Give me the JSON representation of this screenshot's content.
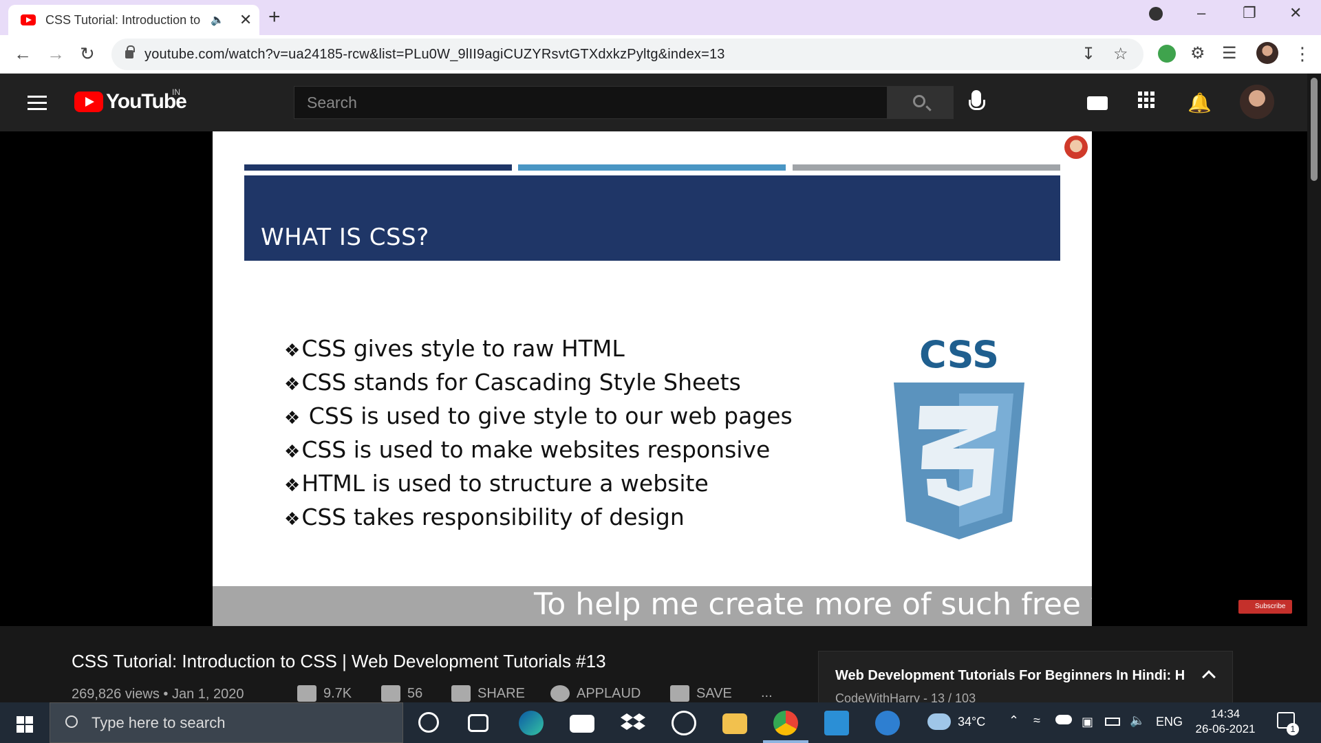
{
  "browser": {
    "tab_title": "CSS Tutorial: Introduction to",
    "url": "youtube.com/watch?v=ua24185-rcw&list=PLu0W_9lII9agiCUZYRsvtGTXdxkzPyltg&index=13"
  },
  "youtube": {
    "country_code": "IN",
    "logo_text": "YouTube",
    "search_placeholder": "Search"
  },
  "slide": {
    "heading": "WHAT IS CSS?",
    "bullets": [
      "CSS gives style to raw HTML",
      "CSS stands for Cascading Style Sheets",
      " CSS is used to give style to our web pages",
      "CSS is used to make websites responsive",
      "HTML is used to structure a website",
      "CSS takes responsibility of design"
    ],
    "logo_text": "CSS",
    "subtitle": "To help me create more of such free video",
    "subscribe_badge": "Subscribe",
    "stripe_colors": [
      "#1f3667",
      "#4a96c4",
      "#a0a4a8"
    ]
  },
  "video": {
    "title": "CSS Tutorial: Introduction to CSS | Web Development Tutorials #13",
    "meta": "269,826 views • Jan 1, 2020",
    "likes": "9.7K",
    "dislikes": "56",
    "share": "SHARE",
    "applaud": "APPLAUD",
    "save": "SAVE",
    "more": "..."
  },
  "playlist": {
    "title": "Web Development Tutorials For Beginners In Hindi: H",
    "channel_position": "CodeWithHarry - 13 / 103"
  },
  "taskbar": {
    "search_placeholder": "Type here to search",
    "weather": "34°C",
    "language": "ENG",
    "time": "14:34",
    "date": "26-06-2021",
    "notification_count": "1"
  }
}
